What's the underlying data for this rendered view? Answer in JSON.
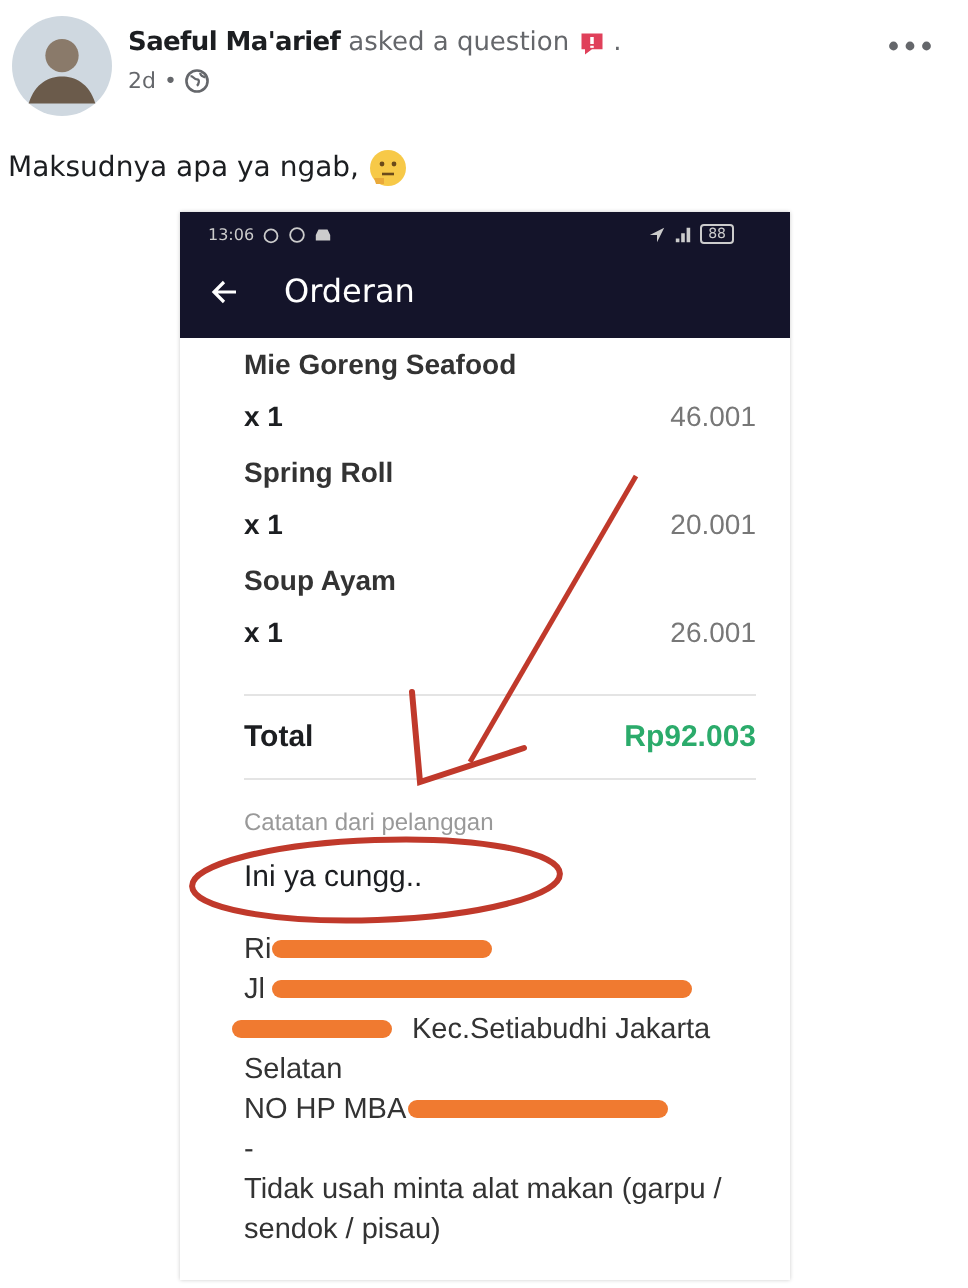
{
  "post": {
    "author": "Saeful Ma'arief",
    "action": "asked a question",
    "after_badge": ".",
    "time": "2d",
    "separator": "•",
    "text": "Maksudnya apa ya ngab,"
  },
  "phone": {
    "status_time": "13:06",
    "battery": "88",
    "title": "Orderan",
    "items": [
      {
        "name": "Mie Goreng Seafood",
        "qty": "x 1",
        "price": "46.001"
      },
      {
        "name": "Spring Roll",
        "qty": "x 1",
        "price": "20.001"
      },
      {
        "name": "Soup Ayam",
        "qty": "x 1",
        "price": "26.001"
      }
    ],
    "total_label": "Total",
    "total": "Rp92.003",
    "note_label": "Catatan dari pelanggan",
    "note": "Ini ya cungg..",
    "address_lines": [
      {
        "text": "Ri",
        "redacted": true
      },
      {
        "text": "Jl",
        "redacted": true
      },
      {
        "text": "Kec.Setiabudhi Jakarta",
        "redacted": true
      },
      {
        "text": "Selatan",
        "redacted": false
      },
      {
        "text": "NO HP MBA",
        "redacted": true
      },
      {
        "text": "-",
        "redacted": false
      },
      {
        "text": "Tidak usah minta alat makan (garpu / sendok / pisau)",
        "redacted": false
      }
    ]
  }
}
